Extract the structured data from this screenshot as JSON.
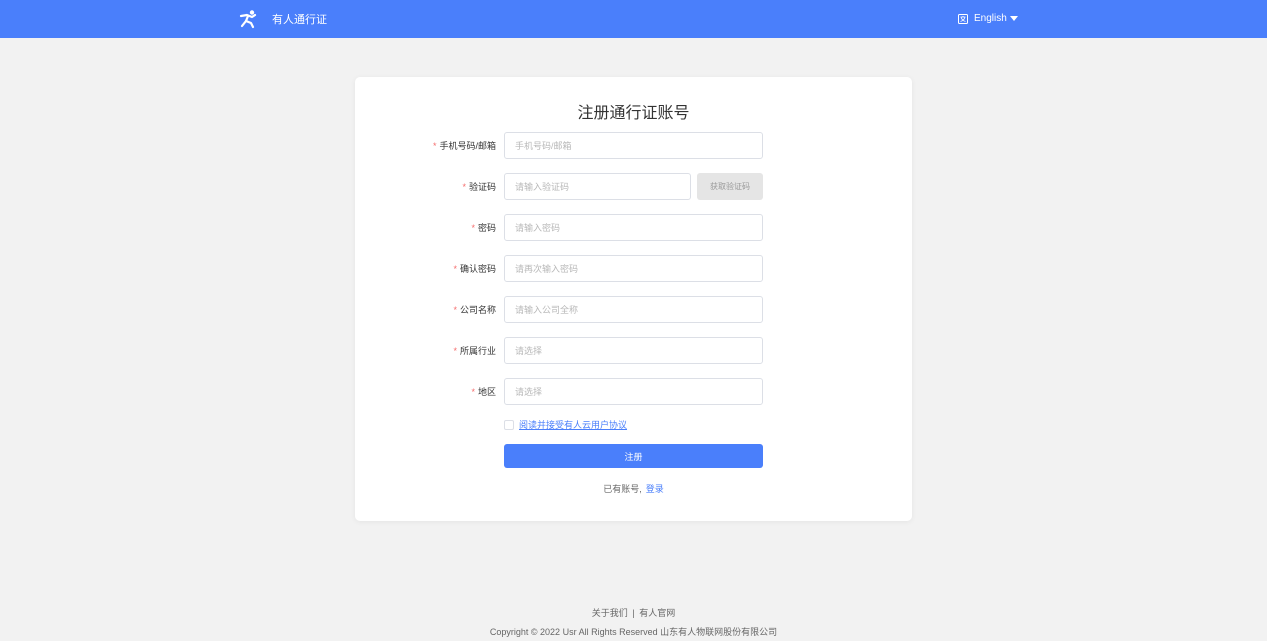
{
  "header": {
    "brand_name": "有人通行证",
    "language_label": "English",
    "accent_color": "#4a7ffb"
  },
  "form": {
    "title": "注册通行证账号",
    "required_mark": "*",
    "fields": [
      {
        "label": "手机号码/邮箱",
        "placeholder": "手机号码/邮箱",
        "value": ""
      },
      {
        "label": "验证码",
        "placeholder": "请输入验证码",
        "value": ""
      },
      {
        "label": "密码",
        "placeholder": "请输入密码",
        "value": ""
      },
      {
        "label": "确认密码",
        "placeholder": "请再次输入密码",
        "value": ""
      },
      {
        "label": "公司名称",
        "placeholder": "请输入公司全称",
        "value": ""
      },
      {
        "label": "所属行业",
        "placeholder": "请选择",
        "value": ""
      },
      {
        "label": "地区",
        "placeholder": "请选择",
        "value": ""
      }
    ],
    "get_code_label": "获取验证码",
    "agreement_label": "阅读并接受有人云用户协议",
    "agreement_checked": false,
    "submit_label": "注册",
    "have_account_text": "已有账号,",
    "login_label": "登录"
  },
  "footer": {
    "about_label": "关于我们",
    "separator": "|",
    "official_site_label": "有人官网",
    "copyright": "Copyright © 2022 Usr All Rights Reserved 山东有人物联网股份有限公司"
  }
}
